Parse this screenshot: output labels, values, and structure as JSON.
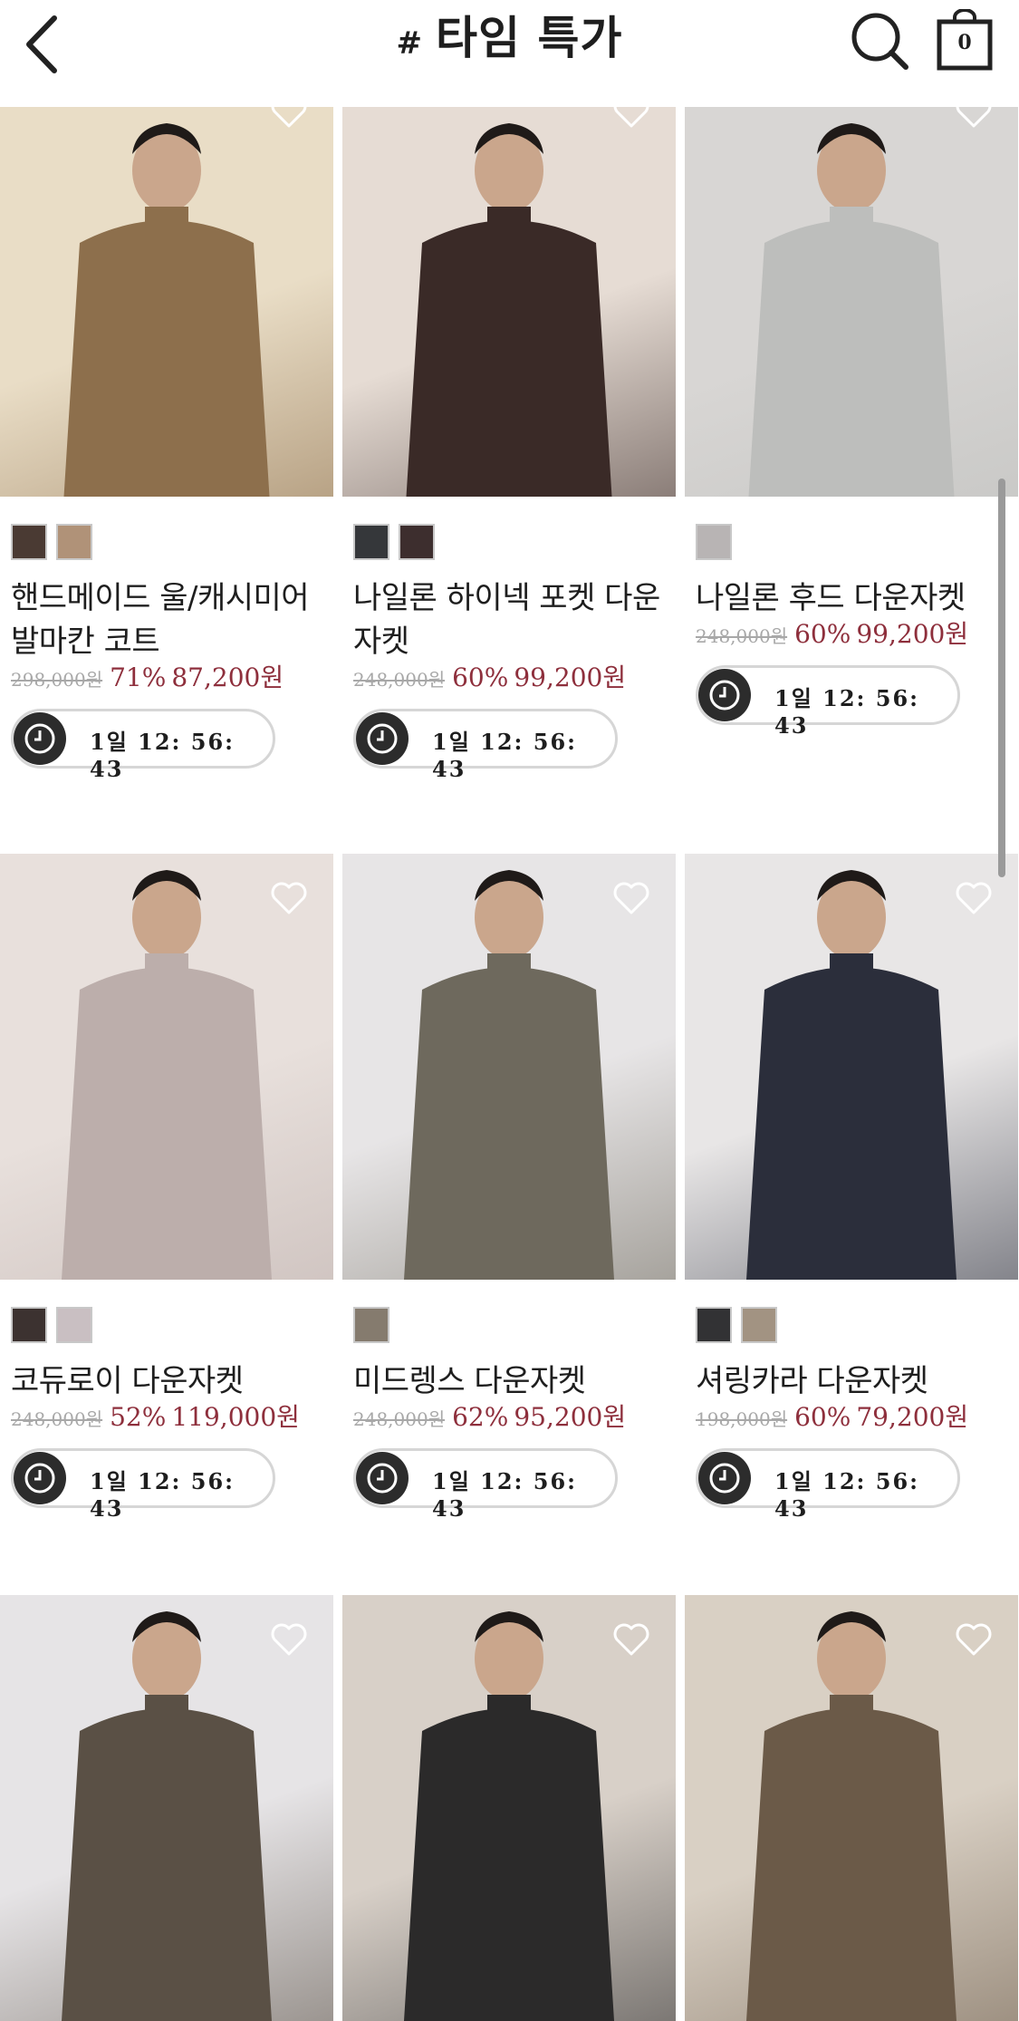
{
  "header": {
    "title_hash": "#",
    "title": "타임 특가",
    "back_icon": "chevron-left-icon",
    "search_icon": "search-icon",
    "cart_icon": "shopping-bag-icon",
    "cart_count": "0"
  },
  "products": [
    {
      "name": "핸드메이드 울/캐시미어 발마칸 코트",
      "original_price": "298,000원",
      "discount": "71%",
      "sale_price": "87,200원",
      "countdown": "1일 12: 56: 43",
      "swatches": [
        "#4a3a33",
        "#b09278"
      ],
      "photo_colors": [
        "#e9ddc6",
        "#8d6f4c"
      ]
    },
    {
      "name": "나일론 하이넥 포켓 다운자켓",
      "original_price": "248,000원",
      "discount": "60%",
      "sale_price": "99,200원",
      "countdown": "1일 12: 56: 43",
      "swatches": [
        "#35373a",
        "#3d2e2e"
      ],
      "photo_colors": [
        "#e6dcd4",
        "#3a2a27"
      ]
    },
    {
      "name": "나일론 후드 다운자켓",
      "original_price": "248,000원",
      "discount": "60%",
      "sale_price": "99,200원",
      "countdown": "1일 12: 56: 43",
      "swatches": [
        "#b8b4b4"
      ],
      "photo_colors": [
        "#d8d6d4",
        "#bdbebc"
      ]
    },
    {
      "name": "코듀로이 다운자켓",
      "original_price": "248,000원",
      "discount": "52%",
      "sale_price": "119,000원",
      "countdown": "1일 12: 56: 43",
      "swatches": [
        "#3c3230",
        "#c9bfc2"
      ],
      "photo_colors": [
        "#e8e0dc",
        "#bcaeab"
      ]
    },
    {
      "name": "미드렝스 다운자켓",
      "original_price": "248,000원",
      "discount": "62%",
      "sale_price": "95,200원",
      "countdown": "1일 12: 56: 43",
      "swatches": [
        "#857b6e"
      ],
      "photo_colors": [
        "#e7e5e6",
        "#6e695d"
      ]
    },
    {
      "name": "셔링카라 다운자켓",
      "original_price": "198,000원",
      "discount": "60%",
      "sale_price": "79,200원",
      "countdown": "1일 12: 56: 43",
      "swatches": [
        "#323234",
        "#a29382"
      ],
      "photo_colors": [
        "#e8e6e6",
        "#2b2e3b"
      ]
    },
    {
      "name": "",
      "original_price": "",
      "discount": "",
      "sale_price": "",
      "countdown": "",
      "swatches": [],
      "photo_colors": [
        "#e6e4e6",
        "#5a5045"
      ]
    },
    {
      "name": "",
      "original_price": "",
      "discount": "",
      "sale_price": "",
      "countdown": "",
      "swatches": [],
      "photo_colors": [
        "#d8d0c8",
        "#2b2a2a"
      ]
    },
    {
      "name": "",
      "original_price": "",
      "discount": "",
      "sale_price": "",
      "countdown": "",
      "swatches": [],
      "photo_colors": [
        "#d9d0c4",
        "#6b5a48"
      ]
    }
  ]
}
